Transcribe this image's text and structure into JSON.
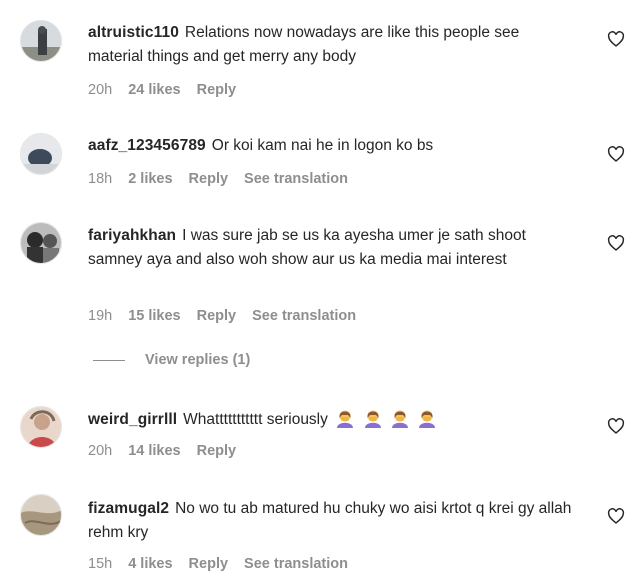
{
  "comments": [
    {
      "username": "altruistic110",
      "text": "Relations now nowadays are like this people see material things and get merry any body",
      "time": "20h",
      "likes": "24 likes",
      "reply": "Reply",
      "translate": ""
    },
    {
      "username": "aafz_123456789",
      "text": "Or koi kam nai he in logon ko bs",
      "time": "18h",
      "likes": "2 likes",
      "reply": "Reply",
      "translate": "See translation"
    },
    {
      "username": "fariyahkhan",
      "text": "I was sure jab se us ka ayesha umer je sath shoot samney aya and also woh show aur us ka media mai interest",
      "time": "19h",
      "likes": "15 likes",
      "reply": "Reply",
      "translate": "See translation",
      "view_replies": "View replies (1)"
    },
    {
      "username": "weird_girrlll",
      "text": "Whattttttttttt seriously",
      "time": "20h",
      "likes": "14 likes",
      "reply": "Reply",
      "translate": "",
      "emoji": "woman-facepalming"
    },
    {
      "username": "fizamugal2",
      "text": "No wo tu ab matured hu chuky wo aisi krtot q krei gy allah rehm kry",
      "time": "15h",
      "likes": "4 likes",
      "reply": "Reply",
      "translate": "See translation"
    }
  ],
  "colors": {
    "text": "#262626",
    "meta": "#8e8e8e",
    "emoji": "#8a6fd1"
  }
}
